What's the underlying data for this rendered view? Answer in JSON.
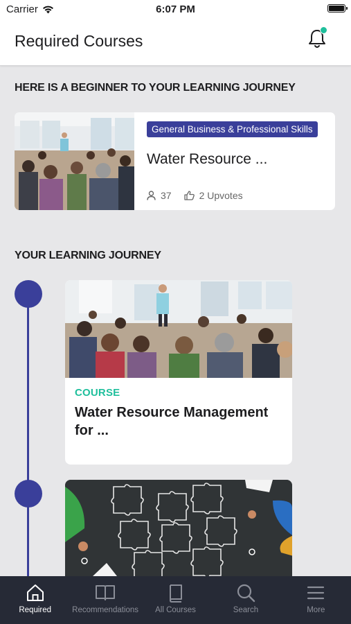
{
  "status_bar": {
    "carrier": "Carrier",
    "time": "6:07 PM"
  },
  "header": {
    "title": "Required Courses"
  },
  "featured_section": {
    "title": "HERE IS A BEGINNER TO YOUR LEARNING JOURNEY"
  },
  "featured_course": {
    "tag": "General Business & Professional Skills",
    "title": "Water Resource ...",
    "learners": "37",
    "upvotes": "2 Upvotes"
  },
  "journey_section": {
    "title": "YOUR LEARNING JOURNEY"
  },
  "journey": [
    {
      "label": "COURSE",
      "title": "Water Resource Management for ..."
    }
  ],
  "tabs": [
    {
      "label": "Required",
      "icon": "home-icon",
      "active": true
    },
    {
      "label": "Recommendations",
      "icon": "book-open-icon",
      "active": false
    },
    {
      "label": "All Courses",
      "icon": "book-icon",
      "active": false
    },
    {
      "label": "Search",
      "icon": "search-icon",
      "active": false
    },
    {
      "label": "More",
      "icon": "menu-icon",
      "active": false
    }
  ],
  "colors": {
    "accent": "#3a3f9a",
    "teal": "#1fbf9c",
    "tabbar_bg": "#262a36",
    "background": "#e7e7e9"
  }
}
